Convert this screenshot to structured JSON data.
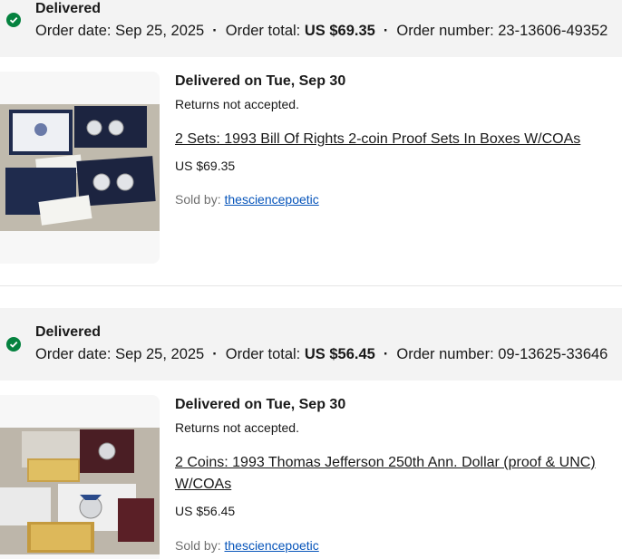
{
  "orders": [
    {
      "status": "Delivered",
      "order_date_label": "Order date:",
      "order_date": "Sep 25, 2025",
      "order_total_label": "Order total:",
      "order_total": "US $69.35",
      "order_number_label": "Order number:",
      "order_number": "23-13606-49352",
      "delivered_on": "Delivered on Tue, Sep 30",
      "returns": "Returns not accepted.",
      "item_title": "2 Sets: 1993 Bill Of Rights 2-coin Proof Sets In Boxes W/COAs",
      "item_price": "US $69.35",
      "sold_by_label": "Sold by:",
      "seller": "thesciencepoetic",
      "thumbnail_icon": "coin-proof-sets-photo"
    },
    {
      "status": "Delivered",
      "order_date_label": "Order date:",
      "order_date": "Sep 25, 2025",
      "order_total_label": "Order total:",
      "order_total": "US $56.45",
      "order_number_label": "Order number:",
      "order_number": "09-13625-33646",
      "delivered_on": "Delivered on Tue, Sep 30",
      "returns": "Returns not accepted.",
      "item_title": "2 Coins: 1993 Thomas Jefferson 250th Ann. Dollar (proof & UNC) W/COAs",
      "item_price": "US $56.45",
      "sold_by_label": "Sold by:",
      "seller": "thesciencepoetic",
      "thumbnail_icon": "jefferson-dollar-photo"
    }
  ],
  "colors": {
    "success": "#05823f",
    "link": "#0654ba",
    "band": "#f3f3f3"
  }
}
